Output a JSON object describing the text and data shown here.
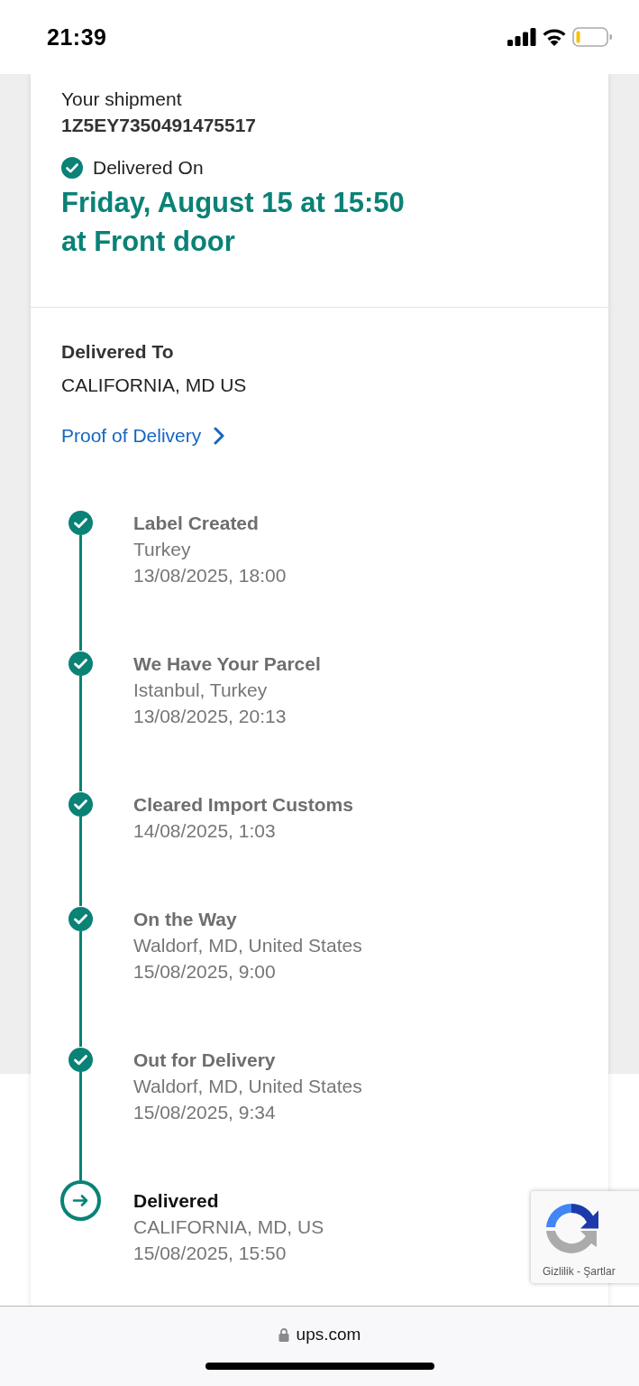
{
  "status_bar": {
    "time": "21:39"
  },
  "shipment": {
    "label": "Your shipment",
    "tracking_number": "1Z5EY7350491475517",
    "status": "Delivered On",
    "delivery_date": "Friday, August 15 at 15:50",
    "delivery_place": "at Front door"
  },
  "delivered_to": {
    "label": "Delivered To",
    "address": "CALIFORNIA, MD US"
  },
  "proof_link": "Proof of Delivery",
  "timeline": [
    {
      "kind": "done",
      "title": "Label Created",
      "lines": [
        "Turkey",
        "13/08/2025, 18:00"
      ]
    },
    {
      "kind": "done",
      "title": "We Have Your Parcel",
      "lines": [
        "Istanbul, Turkey",
        "13/08/2025, 20:13"
      ]
    },
    {
      "kind": "done",
      "title": "Cleared Import Customs",
      "lines": [
        "14/08/2025, 1:03"
      ]
    },
    {
      "kind": "done",
      "title": "On the Way",
      "lines": [
        "Waldorf, MD, United States",
        "15/08/2025, 9:00"
      ]
    },
    {
      "kind": "done",
      "title": "Out for Delivery",
      "lines": [
        "Waldorf, MD, United States",
        "15/08/2025, 9:34"
      ]
    },
    {
      "kind": "current",
      "title": "Delivered",
      "lines": [
        "CALIFORNIA, MD, US",
        "15/08/2025, 15:50"
      ]
    }
  ],
  "recaptcha": {
    "links": "Gizlilik - Şartlar"
  },
  "browser_bar": {
    "url": "ups.com"
  }
}
